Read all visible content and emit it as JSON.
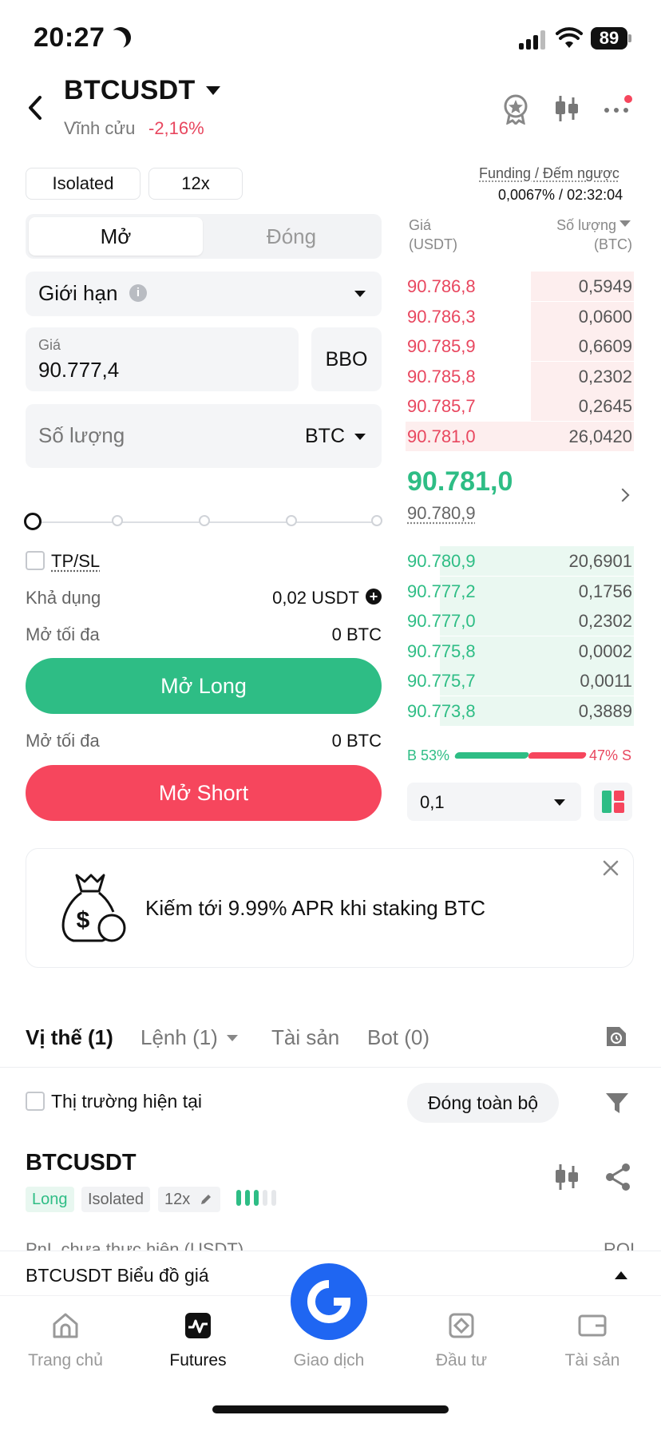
{
  "status_bar": {
    "time": "20:27",
    "battery": "89"
  },
  "header": {
    "pair": "BTCUSDT",
    "subtitle": "Vĩnh cửu",
    "change": "-2,16%"
  },
  "order_form": {
    "margin_mode": "Isolated",
    "leverage": "12x",
    "tabs": [
      "Mở",
      "Đóng"
    ],
    "order_type": "Giới hạn",
    "price_label": "Giá",
    "price_value": "90.777,4",
    "bbo_label": "BBO",
    "qty_placeholder": "Số lượng",
    "qty_unit": "BTC",
    "slider_percent": 0,
    "tpsl_label": "TP/SL",
    "available_label": "Khả dụng",
    "available_value": "0,02 USDT",
    "max_open_label": "Mở tối đa",
    "max_open_long": "0 BTC",
    "max_open_short": "0 BTC",
    "long_button": "Mở Long",
    "short_button": "Mở Short"
  },
  "orderbook": {
    "funding_label": "Funding / Đếm ngược",
    "funding_value": "0,0067% / 02:32:04",
    "price_header": "Giá",
    "price_unit": "(USDT)",
    "qty_header": "Số lượng",
    "qty_unit": "(BTC)",
    "asks": [
      {
        "price": "90.786,8",
        "qty": "0,5949",
        "depth": 0.45
      },
      {
        "price": "90.786,3",
        "qty": "0,0600",
        "depth": 0.45
      },
      {
        "price": "90.785,9",
        "qty": "0,6609",
        "depth": 0.45
      },
      {
        "price": "90.785,8",
        "qty": "0,2302",
        "depth": 0.45
      },
      {
        "price": "90.785,7",
        "qty": "0,2645",
        "depth": 0.45
      },
      {
        "price": "90.781,0",
        "qty": "26,0420",
        "depth": 1.0
      }
    ],
    "last_price": "90.781,0",
    "mark_price": "90.780,9",
    "bids": [
      {
        "price": "90.780,9",
        "qty": "20,6901",
        "depth": 0.85
      },
      {
        "price": "90.777,2",
        "qty": "0,1756",
        "depth": 0.85
      },
      {
        "price": "90.777,0",
        "qty": "0,2302",
        "depth": 0.85
      },
      {
        "price": "90.775,8",
        "qty": "0,0002",
        "depth": 0.85
      },
      {
        "price": "90.775,7",
        "qty": "0,0011",
        "depth": 0.85
      },
      {
        "price": "90.773,8",
        "qty": "0,3889",
        "depth": 0.85
      }
    ],
    "buy_ratio": "B 53%",
    "sell_ratio": "47% S",
    "depth_step": "0,1"
  },
  "promo": {
    "text": "Kiếm tới 9.99% APR khi staking BTC"
  },
  "positions_tabs": {
    "positions": "Vị thế (1)",
    "orders": "Lệnh (1)",
    "assets": "Tài sản",
    "bots": "Bot (0)"
  },
  "positions": {
    "current_market_label": "Thị trường hiện tại",
    "close_all": "Đóng toàn bộ",
    "symbol": "BTCUSDT",
    "side": "Long",
    "margin": "Isolated",
    "leverage": "12x",
    "pnl_label": "PnL chưa thực hiện (USDT)",
    "roi_label": "ROI"
  },
  "chart_bar": {
    "label": "BTCUSDT Biểu đồ giá"
  },
  "bottom_nav": {
    "items": [
      "Trang chủ",
      "Futures",
      "Giao dịch",
      "Đầu tư",
      "Tài sản"
    ]
  },
  "colors": {
    "green": "#2ebd85",
    "red": "#f6465d",
    "blue": "#1f66f2"
  }
}
